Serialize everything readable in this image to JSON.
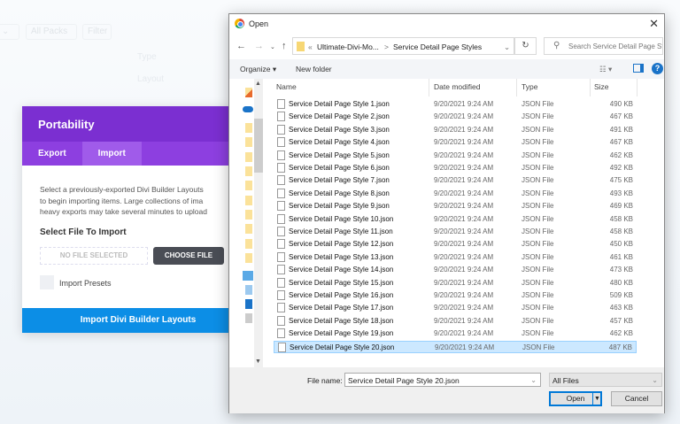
{
  "background": {
    "filter_packs": "All Packs",
    "filter_button": "Filter",
    "col_type": "Type",
    "col_layout": "Layout"
  },
  "divi": {
    "title": "Portability",
    "tabs": [
      "Export",
      "Import"
    ],
    "description": [
      "Select a previously-exported Divi Builder Layouts",
      "to begin importing items. Large collections of ima",
      "heavy exports may take several minutes to upload"
    ],
    "select_label": "Select File To Import",
    "no_file": "NO FILE SELECTED",
    "choose_file": "CHOOSE FILE",
    "import_presets": "Import Presets",
    "import_button": "Import Divi Builder Layouts"
  },
  "dialog": {
    "title": "Open",
    "path": {
      "prefix": "«",
      "parent": "Ultimate-Divi-Mo...",
      "sep": ">",
      "current": "Service Detail Page Styles"
    },
    "search_placeholder": "Search Service Detail Page St...",
    "organize": "Organize ▾",
    "new_folder": "New folder",
    "columns": {
      "name": "Name",
      "date": "Date modified",
      "type": "Type",
      "size": "Size"
    },
    "files": [
      {
        "name": "Service Detail Page Style 1.json",
        "date": "9/20/2021 9:24 AM",
        "type": "JSON File",
        "size": "490 KB"
      },
      {
        "name": "Service Detail Page Style 2.json",
        "date": "9/20/2021 9:24 AM",
        "type": "JSON File",
        "size": "467 KB"
      },
      {
        "name": "Service Detail Page Style 3.json",
        "date": "9/20/2021 9:24 AM",
        "type": "JSON File",
        "size": "491 KB"
      },
      {
        "name": "Service Detail Page Style 4.json",
        "date": "9/20/2021 9:24 AM",
        "type": "JSON File",
        "size": "467 KB"
      },
      {
        "name": "Service Detail Page Style 5.json",
        "date": "9/20/2021 9:24 AM",
        "type": "JSON File",
        "size": "462 KB"
      },
      {
        "name": "Service Detail Page Style 6.json",
        "date": "9/20/2021 9:24 AM",
        "type": "JSON File",
        "size": "492 KB"
      },
      {
        "name": "Service Detail Page Style 7.json",
        "date": "9/20/2021 9:24 AM",
        "type": "JSON File",
        "size": "475 KB"
      },
      {
        "name": "Service Detail Page Style 8.json",
        "date": "9/20/2021 9:24 AM",
        "type": "JSON File",
        "size": "493 KB"
      },
      {
        "name": "Service Detail Page Style 9.json",
        "date": "9/20/2021 9:24 AM",
        "type": "JSON File",
        "size": "469 KB"
      },
      {
        "name": "Service Detail Page Style 10.json",
        "date": "9/20/2021 9:24 AM",
        "type": "JSON File",
        "size": "458 KB"
      },
      {
        "name": "Service Detail Page Style 11.json",
        "date": "9/20/2021 9:24 AM",
        "type": "JSON File",
        "size": "458 KB"
      },
      {
        "name": "Service Detail Page Style 12.json",
        "date": "9/20/2021 9:24 AM",
        "type": "JSON File",
        "size": "450 KB"
      },
      {
        "name": "Service Detail Page Style 13.json",
        "date": "9/20/2021 9:24 AM",
        "type": "JSON File",
        "size": "461 KB"
      },
      {
        "name": "Service Detail Page Style 14.json",
        "date": "9/20/2021 9:24 AM",
        "type": "JSON File",
        "size": "473 KB"
      },
      {
        "name": "Service Detail Page Style 15.json",
        "date": "9/20/2021 9:24 AM",
        "type": "JSON File",
        "size": "480 KB"
      },
      {
        "name": "Service Detail Page Style 16.json",
        "date": "9/20/2021 9:24 AM",
        "type": "JSON File",
        "size": "509 KB"
      },
      {
        "name": "Service Detail Page Style 17.json",
        "date": "9/20/2021 9:24 AM",
        "type": "JSON File",
        "size": "463 KB"
      },
      {
        "name": "Service Detail Page Style 18.json",
        "date": "9/20/2021 9:24 AM",
        "type": "JSON File",
        "size": "457 KB"
      },
      {
        "name": "Service Detail Page Style 19.json",
        "date": "9/20/2021 9:24 AM",
        "type": "JSON File",
        "size": "462 KB"
      },
      {
        "name": "Service Detail Page Style 20.json",
        "date": "9/20/2021 9:24 AM",
        "type": "JSON File",
        "size": "487 KB"
      }
    ],
    "selected_index": 19,
    "file_name_label": "File name:",
    "file_name_value": "Service Detail Page Style 20.json",
    "filter": "All Files",
    "open": "Open",
    "cancel": "Cancel"
  }
}
